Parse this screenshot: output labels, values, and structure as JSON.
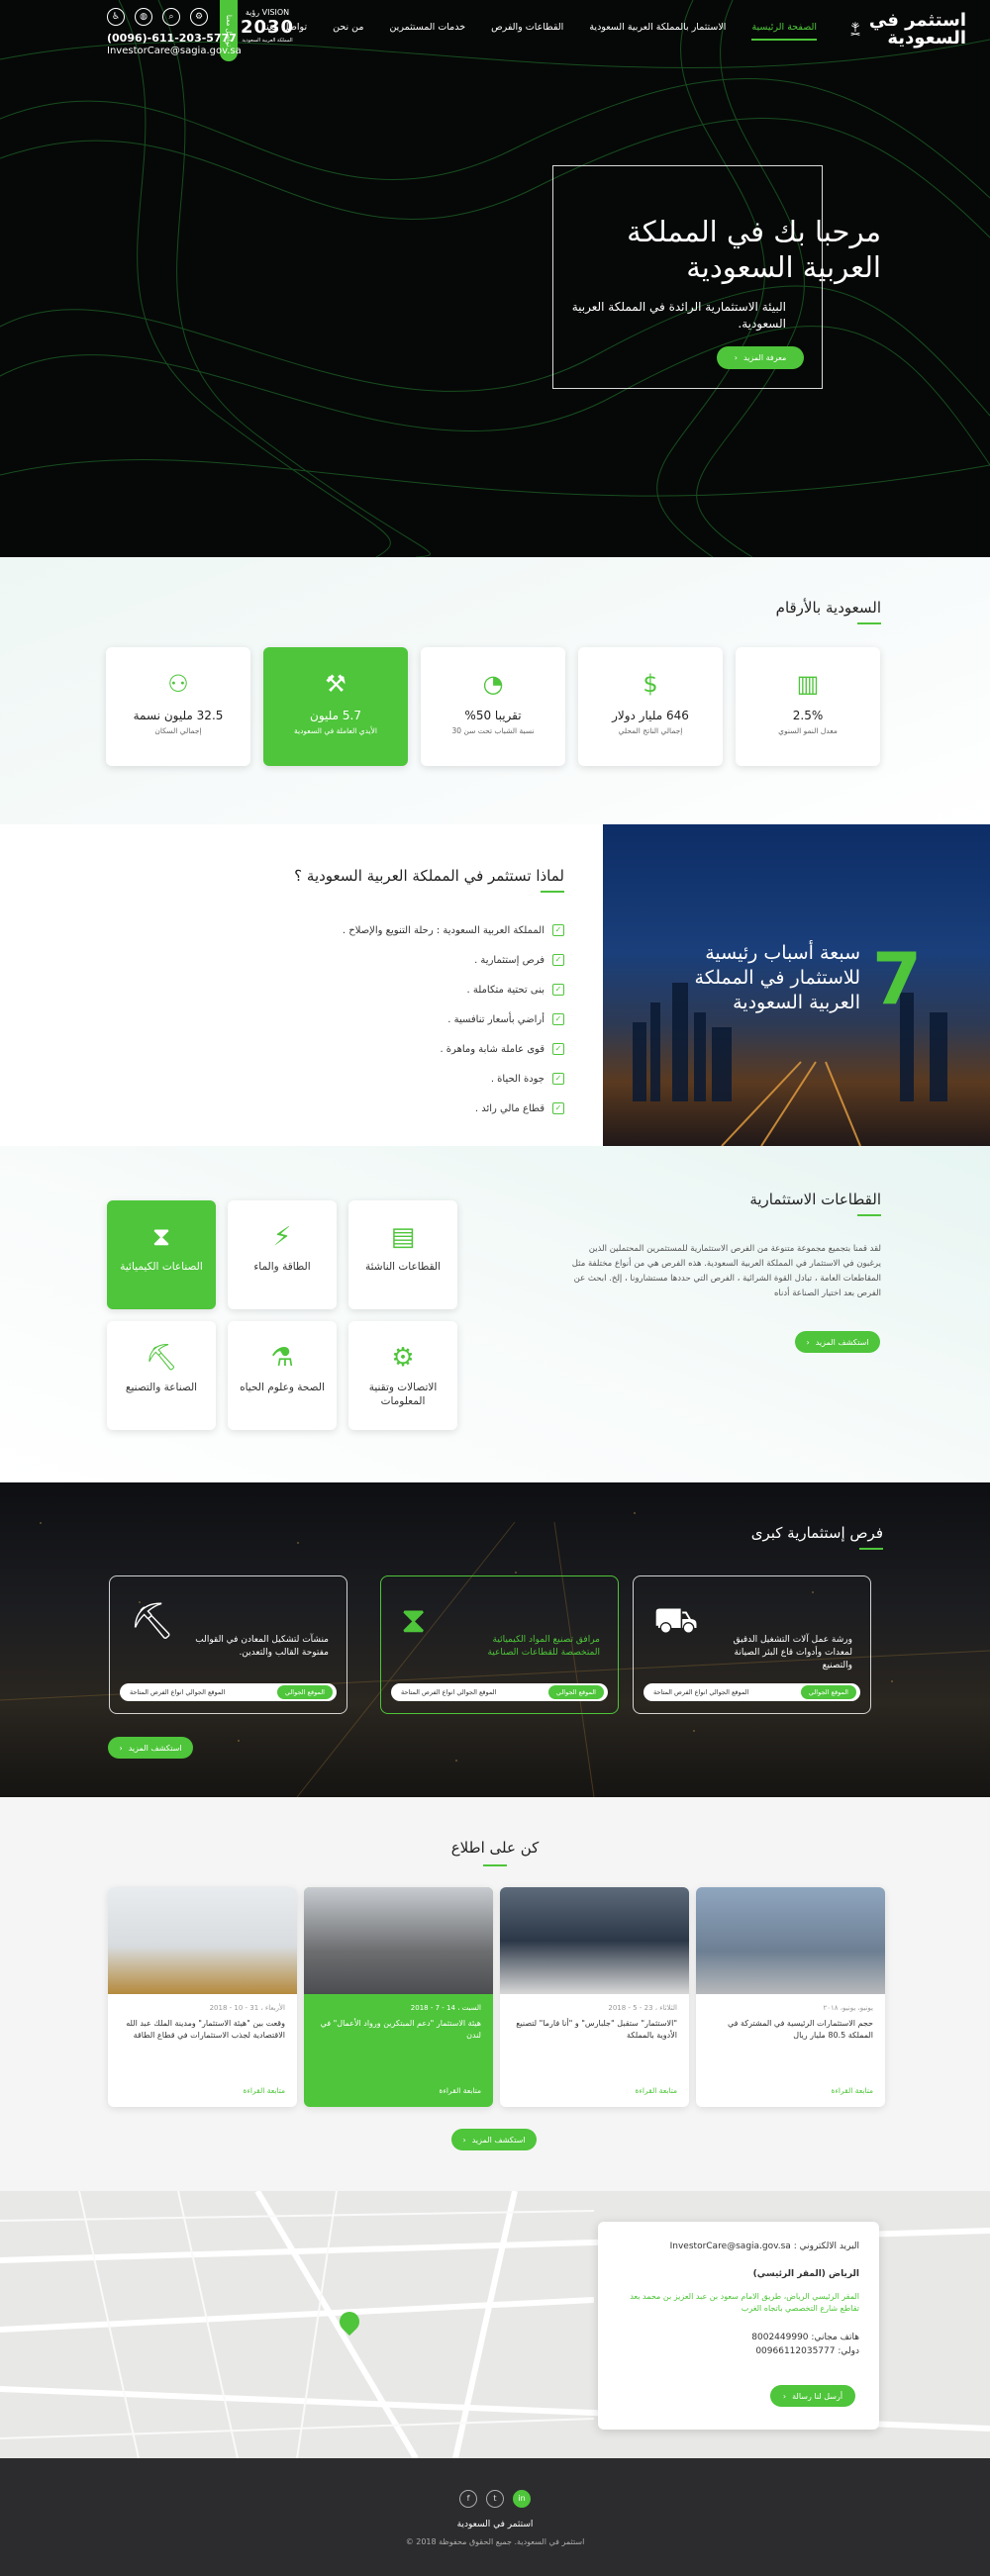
{
  "header": {
    "logo_text": "استثمر في السعودية",
    "nav": [
      "الصفحة الرئيسية",
      "الاستثمار بالمملكة العربية السعودية",
      "القطاعات والفرص",
      "خدمات المستثمرين",
      "من نحن",
      "تواصل معنا"
    ],
    "vision_label": "VISION رؤية",
    "vision_year": "2030",
    "vision_sub": "المملكة العربية السعودية",
    "call_pill": "تواصل معنا",
    "icons": [
      "gear-icon",
      "search-icon",
      "globe-icon",
      "accessibility-icon"
    ],
    "phone": "(0096)-611-203-5777",
    "email": "InvestorCare@sagia.gov.sa"
  },
  "hero": {
    "title": "مرحبا بك في المملكة العربية السعودية",
    "subtitle": "البيئة الاستثمارية الرائدة في المملكة العربية السعودية.",
    "button": "معرفة المزيد"
  },
  "stats": {
    "title": "السعودية بالأرقام",
    "items": [
      {
        "value": "2.5%",
        "label": "معدل النمو السنوي",
        "icon": "chart-icon"
      },
      {
        "value": "646 مليار دولار",
        "label": "إجمالي الناتج المحلي",
        "icon": "money-icon"
      },
      {
        "value": "تقريبا 50%",
        "label": "نسبة الشباب تحت سن 30",
        "icon": "pie-icon"
      },
      {
        "value": "5.7 مليون",
        "label": "الأيدي العاملة في السعودية",
        "icon": "worker-icon"
      },
      {
        "value": "32.5 مليون نسمة",
        "label": "إجمالي السكان",
        "icon": "people-icon"
      }
    ]
  },
  "why": {
    "title": "لماذا تستثمر في المملكة العربية السعودية ؟",
    "items": [
      "المملكة العربية السعودية : رحلة التنويع والإصلاح .",
      "فرص إستثمارية .",
      "بنى تحتية متكاملة .",
      "أراضي بأسعار تنافسية .",
      "قوى عاملة شابة وماهرة .",
      "جودة الحياة .",
      "قطاع مالي رائد ."
    ],
    "number": "7",
    "number_text": "سبعة أسباب رئيسية للاستثمار في المملكة العربية السعودية"
  },
  "sectors": {
    "title": "القطاعات الاستثمارية",
    "paragraph": "لقد قمنا بتجميع مجموعة متنوعة من الفرص الاستثمارية للمستثمرين المحتملين الذين يرغبون في الاستثمار في المملكة العربية السعودية. هذه الفرص هي من أنواع مختلفة مثل المقاطعات العامة ، تبادل القوة الشرائية ، الفرص التي حددها مستشارونا ، إلخ. ابحث عن الفرص بعد اختيار الصناعة أدناه",
    "button": "استكشف المزيد",
    "items": [
      {
        "label": "القطاعات الناشئة",
        "icon": "building-icon"
      },
      {
        "label": "الطاقة والماء",
        "icon": "energy-icon"
      },
      {
        "label": "الصناعات الكيميائية",
        "icon": "dna-icon"
      },
      {
        "label": "الاتصالات وتقنية المعلومات",
        "icon": "network-icon"
      },
      {
        "label": "الصحة وعلوم الحياه",
        "icon": "microscope-icon"
      },
      {
        "label": "الصناعة والتصنيع",
        "icon": "factory-icon"
      }
    ]
  },
  "opportunities": {
    "title": "فرص إستثمارية كبرى",
    "button": "استكشف المزيد",
    "items": [
      {
        "text": "ورشة عمل آلات التشغيل الدقيق لمعدات وأدوات قاع البئر الصيانة والتصنيع",
        "icon": "excavator-icon",
        "location": "الموقع الجوالي",
        "link": "الموقع الجوالي انواع الفرص المتاحة"
      },
      {
        "text": "مرافق تصنيع المواد الكيميائية المتخصصة للقطاعات الصناعية",
        "icon": "dna-icon",
        "location": "الموقع الجوالي",
        "link": "الموقع الجوالي انواع الفرص المتاحة"
      },
      {
        "text": "منشآت لتشكيل المعادن في القوالب مفتوحة القالب والتعدين.",
        "icon": "pickaxe-icon",
        "location": "الموقع الجوالي",
        "link": "الموقع الجوالي انواع الفرص المتاحة"
      }
    ]
  },
  "news": {
    "title": "كن على اطلاع",
    "button": "استكشف المزيد",
    "items": [
      {
        "date": "يونيو، يونيو، ٢٠١٨",
        "title": "حجم الاستثمارات الرئيسية في المشتركة في المملكة 80.5 مليار ريال",
        "more": "متابعة القراءة"
      },
      {
        "date": "الثلاثاء ، 23 - 5 - 2018",
        "title": "\"الاستثمار\" ستقبل \"جلبارس\" و \"أنا فارما\" لتصنيع الأدوية بالمملكة",
        "more": "متابعة القراءة"
      },
      {
        "date": "السبت ، 14 - 7 - 2018",
        "title": "هيئة الاستثمار \"دعم المبتكرين ورواد الأعمال\" في لندن",
        "more": "متابعة القراءة"
      },
      {
        "date": "الأربعاء ، 31 - 10 - 2018",
        "title": "وقعت بين \"هيئة الاستثمار\" ومدينة الملك عبد الله الاقتصادية لجذب الاستثمارات في قطاع الطاقة",
        "more": "متابعة القراءة"
      }
    ]
  },
  "contact": {
    "email_label": "البريد الالكتروني :",
    "email": "InvestorCare@sagia.gov.sa",
    "office": "الرياض (المقر الرئيسي)",
    "address": "المقر الرئيسي الرياض، طريق الامام سعود بن عبد العزيز بن محمد بعد تقاطع شارع التخصصي باتجاه الغرب",
    "phone_label": "هاتف مجاني:",
    "phone": "8002449990",
    "intl_label": "دولي:",
    "intl": "00966112035777",
    "button": "أرسل لنا رسالة"
  },
  "footer": {
    "social": [
      "facebook-icon",
      "twitter-icon",
      "linkedin-icon"
    ],
    "brand": "استثمر في السعودية",
    "copyright": "استثمر في السعودية. جميع الحقوق محفوظة 2018 ©"
  }
}
